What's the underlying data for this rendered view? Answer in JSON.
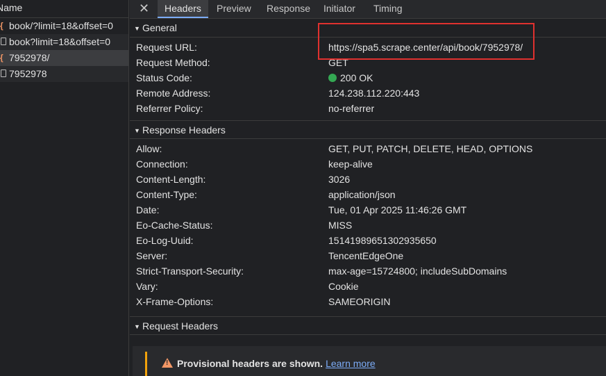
{
  "requests": {
    "header": "Name",
    "rows": [
      {
        "label": "book/?limit=18&offset=0",
        "icon": "json-icon"
      },
      {
        "label": "book?limit=18&offset=0",
        "icon": "document-icon"
      },
      {
        "label": "7952978/",
        "icon": "json-icon"
      },
      {
        "label": "7952978",
        "icon": "document-icon"
      }
    ]
  },
  "tabs": {
    "close": "✕",
    "items": [
      "Headers",
      "Preview",
      "Response",
      "Initiator",
      "Timing"
    ]
  },
  "general": {
    "title": "General",
    "rows": [
      {
        "key": "Request URL:",
        "value": "https://spa5.scrape.center/api/book/7952978/"
      },
      {
        "key": "Request Method:",
        "value": "GET"
      },
      {
        "key": "Status Code:",
        "value": "200 OK"
      },
      {
        "key": "Remote Address:",
        "value": "124.238.112.220:443"
      },
      {
        "key": "Referrer Policy:",
        "value": "no-referrer"
      }
    ]
  },
  "response_headers": {
    "title": "Response Headers",
    "rows": [
      {
        "key": "Allow:",
        "value": "GET, PUT, PATCH, DELETE, HEAD, OPTIONS"
      },
      {
        "key": "Connection:",
        "value": "keep-alive"
      },
      {
        "key": "Content-Length:",
        "value": "3026"
      },
      {
        "key": "Content-Type:",
        "value": "application/json"
      },
      {
        "key": "Date:",
        "value": "Tue, 01 Apr 2025 11:46:26 GMT"
      },
      {
        "key": "Eo-Cache-Status:",
        "value": "MISS"
      },
      {
        "key": "Eo-Log-Uuid:",
        "value": "15141989651302935650"
      },
      {
        "key": "Server:",
        "value": "TencentEdgeOne"
      },
      {
        "key": "Strict-Transport-Security:",
        "value": "max-age=15724800; includeSubDomains"
      },
      {
        "key": "Vary:",
        "value": "Cookie"
      },
      {
        "key": "X-Frame-Options:",
        "value": "SAMEORIGIN"
      }
    ]
  },
  "request_headers": {
    "title": "Request Headers",
    "warning": "Provisional headers are shown.",
    "learn_more": "Learn more"
  },
  "colors": {
    "highlight_box": "#e0312f",
    "status_ok": "#34a853",
    "link": "#7cacf8",
    "warning": "#f2a20b"
  }
}
